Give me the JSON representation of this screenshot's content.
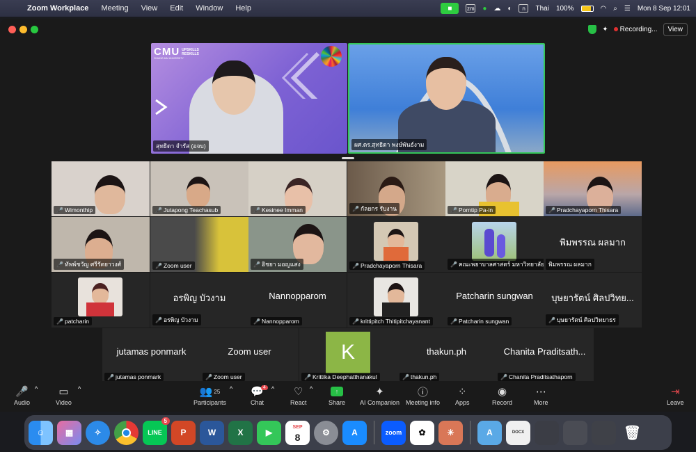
{
  "menubar": {
    "app": "Zoom Workplace",
    "menus": [
      "Meeting",
      "View",
      "Edit",
      "Window",
      "Help"
    ],
    "input_source": "Thai",
    "battery": "100%",
    "datetime": "Mon 8 Sep  12:01"
  },
  "window": {
    "recording": "Recording...",
    "view": "View"
  },
  "speakers": [
    {
      "name": "สุทธิดา จำรัส (อจบ)",
      "logo": "CMU",
      "logo_sub1": "UPSKILLS",
      "logo_sub2": "RESKILLS",
      "logo_caption": "CHIANG MAI UNIVERSITY"
    },
    {
      "name": "ผศ.ดร.สุทธิดา พงษ์พันธ์งาม"
    }
  ],
  "tiles": [
    {
      "label": "Wimonthip",
      "muted": true
    },
    {
      "label": "Jutapong Teachasub",
      "muted": true
    },
    {
      "label": "Kesinee Imman",
      "muted": true
    },
    {
      "label": "กัลยกร รับงาน",
      "muted": true
    },
    {
      "label": "Porntip Pa-in",
      "muted": true
    },
    {
      "label": "Pradchayaporn Thisara",
      "muted": true
    },
    {
      "label": "ทัพพ์ชวัญ ศรีรัตยาวงศ์",
      "muted": true
    },
    {
      "label": "Zoom user",
      "muted": true
    },
    {
      "label": "อิชยา มอญแสง",
      "muted": true
    },
    {
      "label": "Pradchayaporn Thisara",
      "muted": true
    },
    {
      "label": "คณะพยาบาลศาสตร์ มหาวิทยาลัย...",
      "muted": true
    },
    {
      "label": "พิมพรรณ ผลมาก",
      "big": "พิมพรรณ ผลมาก",
      "muted": false
    },
    {
      "label": "patcharin",
      "muted": true
    },
    {
      "label": "อรพิญ บัวงาม",
      "big": "อรพิญ บัวงาม",
      "muted": true
    },
    {
      "label": "Nannopparom",
      "big": "Nannopparom",
      "muted": true
    },
    {
      "label": "krittipitch Thitipitchayanant",
      "muted": true
    },
    {
      "label": "Patcharin sungwan",
      "big": "Patcharin sungwan",
      "muted": true
    },
    {
      "label": "บุษยารัตน์ ศิลปวิทยาธร",
      "big": "บุษยารัตน์ ศิลปวิทย...",
      "muted": true
    },
    {
      "label": "jutamas ponmark",
      "big": "jutamas ponmark",
      "muted": true
    },
    {
      "label": "Zoom user",
      "big": "Zoom user",
      "muted": true
    },
    {
      "label": "Krittika Deephatthanakul",
      "avatar": "K",
      "muted": true
    },
    {
      "label": "thakun.ph",
      "big": "thakun.ph",
      "muted": true
    },
    {
      "label": "Chanita Praditsathaporn",
      "big": "Chanita Praditsath...",
      "muted": true
    }
  ],
  "controls": {
    "audio": "Audio",
    "video": "Video",
    "participants": "Participants",
    "participant_count": "25",
    "chat": "Chat",
    "chat_badge": "4",
    "react": "React",
    "share": "Share",
    "ai": "AI Companion",
    "info": "Meeting info",
    "apps": "Apps",
    "record": "Record",
    "more": "More",
    "leave": "Leave"
  },
  "dock": {
    "zoom": "zoom",
    "line": "LINE",
    "line_badge": "5",
    "cal_month": "SEP",
    "cal_day": "8",
    "docx": "DOCX"
  }
}
